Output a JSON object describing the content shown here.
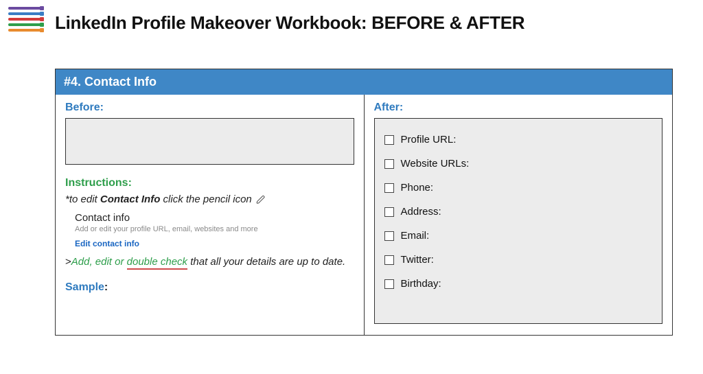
{
  "page": {
    "title": "LinkedIn Profile Makeover Workbook: BEFORE & AFTER"
  },
  "section": {
    "header": "#4. Contact Info",
    "before_label": "Before:",
    "after_label": "After:",
    "instructions_label": "Instructions:",
    "sample_label": "Sample",
    "sample_colon": ":"
  },
  "instructions": {
    "line1_prefix": "*to edit ",
    "line1_bold": "Contact Info",
    "line1_suffix": " click the pencil icon",
    "contact_info_title": "Contact info",
    "contact_info_sub": "Add or edit your profile URL, email, websites and more",
    "edit_link": "Edit contact info",
    "line2_gt": ">",
    "line2_green1": "Add, edit or ",
    "line2_green_underlined": "double check",
    "line2_tail": " that all your details are up to date."
  },
  "after_checklist": [
    "Profile URL:",
    "Website URLs:",
    "Phone:",
    "Address:",
    "Email:",
    "Twitter:",
    "Birthday:"
  ]
}
